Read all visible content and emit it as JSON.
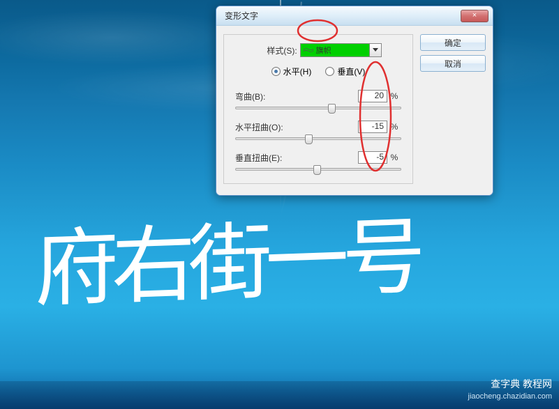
{
  "dialog": {
    "title": "变形文字",
    "close_symbol": "×",
    "style_label": "样式(S):",
    "style_value": "旗帜",
    "radio_horizontal": "水平(H)",
    "radio_vertical": "垂直(V)",
    "orientation": "horizontal",
    "bend": {
      "label": "弯曲(B):",
      "value": "20",
      "unit": "%"
    },
    "h_distort": {
      "label": "水平扭曲(O):",
      "value": "-15",
      "unit": "%"
    },
    "v_distort": {
      "label": "垂直扭曲(E):",
      "value": "-5",
      "unit": "%"
    },
    "buttons": {
      "ok": "确定",
      "cancel": "取消"
    }
  },
  "main_text": "府右街一号",
  "watermark": {
    "line1": "查字典 教程网",
    "line2": "jiaocheng.chazidian.com"
  }
}
